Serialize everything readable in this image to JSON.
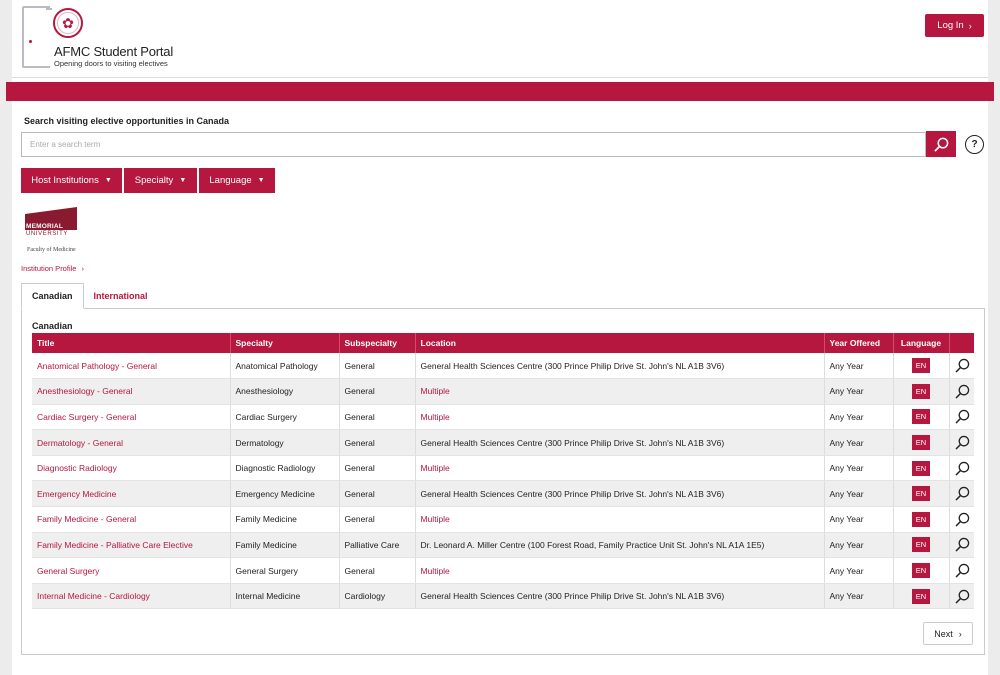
{
  "header": {
    "brand_title": "AFMC Student Portal",
    "brand_subtitle": "Opening doors to visiting electives",
    "login_label": "Log In"
  },
  "search": {
    "label": "Search visiting elective opportunities in Canada",
    "placeholder": "Enter a search term",
    "help_label": "?"
  },
  "filters": [
    {
      "label": "Host Institutions"
    },
    {
      "label": "Specialty"
    },
    {
      "label": "Language"
    }
  ],
  "institution": {
    "logo_word1": "MEMORIAL",
    "logo_word2": "UNIVERSITY",
    "logo_faculty": "Faculty of Medicine",
    "profile_link": "Institution Profile"
  },
  "tabs": [
    {
      "label": "Canadian",
      "active": true
    },
    {
      "label": "International",
      "active": false
    }
  ],
  "panel_title": "Canadian",
  "table": {
    "headers": [
      "Title",
      "Specialty",
      "Subspecialty",
      "Location",
      "Year Offered",
      "Language"
    ],
    "rows": [
      {
        "title": "Anatomical Pathology - General",
        "specialty": "Anatomical Pathology",
        "subspecialty": "General",
        "location": "General Health Sciences Centre (300 Prince Philip Drive St. John's NL A1B 3V6)",
        "year": "Any Year",
        "language": "EN"
      },
      {
        "title": "Anesthesiology - General",
        "specialty": "Anesthesiology",
        "subspecialty": "General",
        "location": "Multiple",
        "year": "Any Year",
        "language": "EN"
      },
      {
        "title": "Cardiac Surgery - General",
        "specialty": "Cardiac Surgery",
        "subspecialty": "General",
        "location": "Multiple",
        "year": "Any Year",
        "language": "EN"
      },
      {
        "title": "Dermatology - General",
        "specialty": "Dermatology",
        "subspecialty": "General",
        "location": "General Health Sciences Centre (300 Prince Philip Drive St. John's NL A1B 3V6)",
        "year": "Any Year",
        "language": "EN"
      },
      {
        "title": "Diagnostic Radiology",
        "specialty": "Diagnostic Radiology",
        "subspecialty": "General",
        "location": "Multiple",
        "year": "Any Year",
        "language": "EN"
      },
      {
        "title": "Emergency Medicine",
        "specialty": "Emergency Medicine",
        "subspecialty": "General",
        "location": "General Health Sciences Centre (300 Prince Philip Drive St. John's NL A1B 3V6)",
        "year": "Any Year",
        "language": "EN"
      },
      {
        "title": "Family Medicine - General",
        "specialty": "Family Medicine",
        "subspecialty": "General",
        "location": "Multiple",
        "year": "Any Year",
        "language": "EN"
      },
      {
        "title": "Family Medicine - Palliative Care Elective",
        "specialty": "Family Medicine",
        "subspecialty": "Palliative Care",
        "location": "Dr. Leonard A. Miller Centre (100 Forest Road, Family Practice Unit St. John's NL A1A 1E5)",
        "year": "Any Year",
        "language": "EN"
      },
      {
        "title": "General Surgery",
        "specialty": "General Surgery",
        "subspecialty": "General",
        "location": "Multiple",
        "year": "Any Year",
        "language": "EN"
      },
      {
        "title": "Internal Medicine - Cardiology",
        "specialty": "Internal Medicine",
        "subspecialty": "Cardiology",
        "location": "General Health Sciences Centre (300 Prince Philip Drive St. John's NL A1B 3V6)",
        "year": "Any Year",
        "language": "EN"
      }
    ]
  },
  "pagination": {
    "next_label": "Next"
  },
  "colors": {
    "brand": "#b5173e"
  },
  "icons": {
    "seal": "maple-leaf-seal-icon",
    "search": "magnifier-icon",
    "view": "magnifier-icon"
  }
}
